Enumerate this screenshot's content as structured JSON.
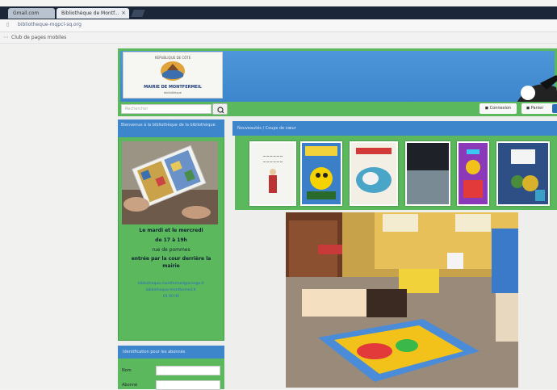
{
  "browser": {
    "tabs": [
      {
        "label": "Gmail.com"
      },
      {
        "label": "Bibliothèque de Montf..."
      }
    ],
    "url": "bibliotheque-mqpcl-sq.org",
    "bookmark": "Club de pages mobiles"
  },
  "header": {
    "logo_top": "RÉPUBLIQUE DE CÔTE",
    "logo_title": "MAIRIE DE MONTFERMEIL",
    "logo_sub": "bibliothèque"
  },
  "navbar": {
    "search_placeholder": "Rechercher",
    "connexion_label": "Connexion",
    "panier_label": "Panier"
  },
  "sidebar": {
    "title": "Bienvenue à la bibliothèque de la bibliothèque",
    "hours_lines": [
      "Le mardi et le mercredi",
      "de 17 à 19h",
      "rue de pommes",
      "entrée par la cour derrière la",
      "mairie"
    ],
    "links": [
      "bibliotheque.montfermeil@orange.fr",
      "bibliotheque-montfermeil.fr",
      "01 00 00"
    ],
    "form_title": "Identification pour les abonnés",
    "form_fields": [
      "Nom",
      "Abonné"
    ]
  },
  "main": {
    "nouveautes_title": "Nouveautés / Coups de cœur"
  },
  "colors": {
    "green": "#5cb85c",
    "blue": "#3e86cc"
  }
}
